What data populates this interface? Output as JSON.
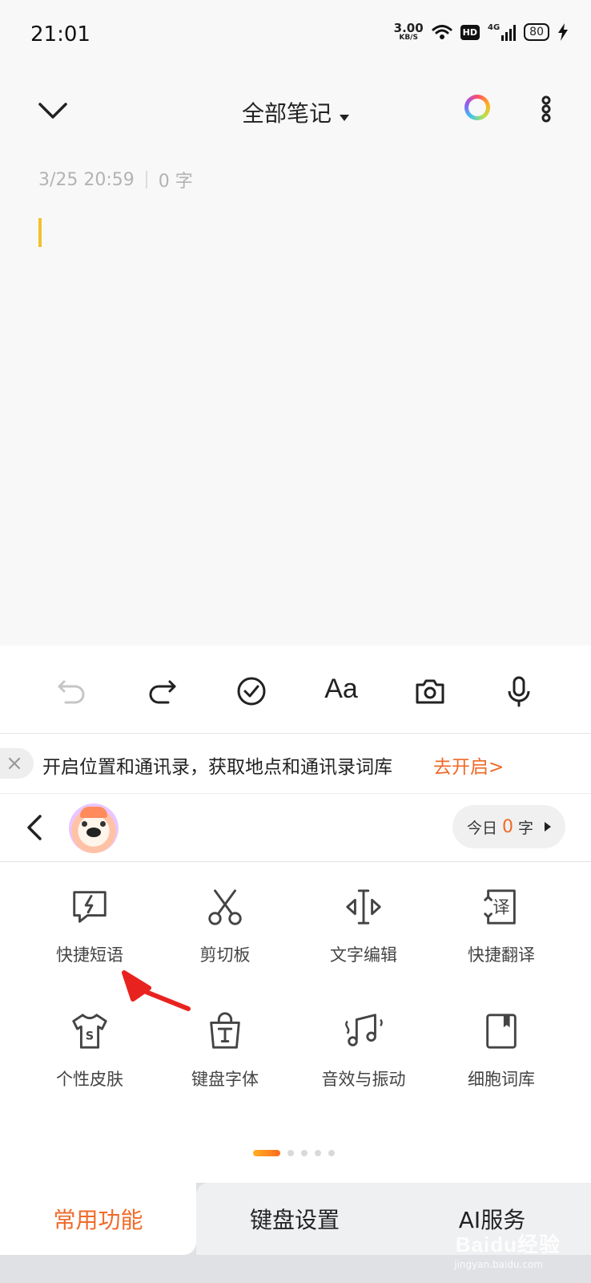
{
  "status_bar": {
    "time": "21:01",
    "net_speed_value": "3.00",
    "net_speed_unit": "KB/S",
    "hd": "HD",
    "network": "4G",
    "battery": "80"
  },
  "header": {
    "title": "全部笔记"
  },
  "note": {
    "date": "3/25 20:59",
    "word_count": "0 字"
  },
  "permission_banner": {
    "text": "开启位置和通讯录，获取地点和通讯录词库",
    "action": "去开启>"
  },
  "keyboard_header": {
    "today_label_prefix": "今日",
    "today_count": "0",
    "today_label_suffix": "字"
  },
  "functions": [
    {
      "label": "快捷短语",
      "icon": "quick-phrase-icon"
    },
    {
      "label": "剪切板",
      "icon": "scissors-icon"
    },
    {
      "label": "文字编辑",
      "icon": "text-edit-icon"
    },
    {
      "label": "快捷翻译",
      "icon": "translate-icon"
    },
    {
      "label": "个性皮肤",
      "icon": "tshirt-icon"
    },
    {
      "label": "键盘字体",
      "icon": "font-bag-icon"
    },
    {
      "label": "音效与振动",
      "icon": "music-note-icon"
    },
    {
      "label": "细胞词库",
      "icon": "book-icon"
    }
  ],
  "pager": {
    "active_page": 1,
    "page_count": 5
  },
  "tabs": {
    "common": "常用功能",
    "keyboard_settings": "键盘设置",
    "ai_services": "AI服务"
  },
  "toolbar": {
    "font_label": "Aa"
  },
  "watermark": {
    "text": "Baidu经验",
    "sub": "jingyan.baidu.com"
  },
  "colors": {
    "accent": "#f06a2a",
    "cursor": "#f2c12e",
    "annotation_arrow": "#e8231f"
  }
}
